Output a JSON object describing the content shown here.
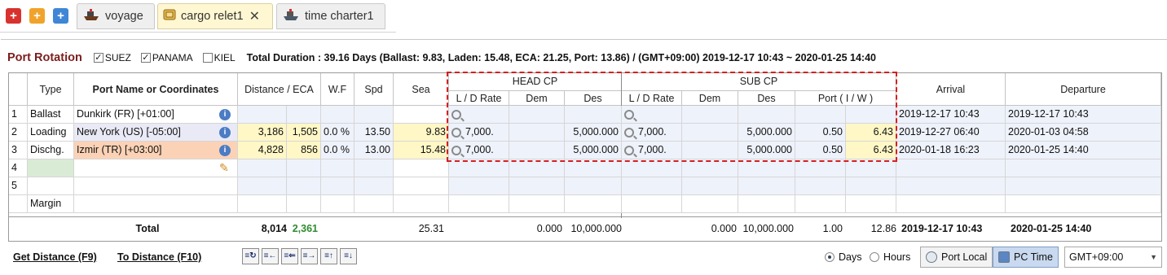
{
  "tabs": [
    {
      "label": "voyage",
      "active": false
    },
    {
      "label": "cargo relet1",
      "active": true
    },
    {
      "label": "time charter1",
      "active": false
    }
  ],
  "header": {
    "title": "Port Rotation",
    "canals": [
      {
        "label": "SUEZ",
        "checked": true
      },
      {
        "label": "PANAMA",
        "checked": true
      },
      {
        "label": "KIEL",
        "checked": false
      }
    ],
    "duration": "Total Duration : 39.16 Days (Ballast: 9.83, Laden: 15.48, ECA: 21.25, Port: 13.86) / (GMT+09:00) 2019-12-17 10:43 ~ 2020-01-25 14:40"
  },
  "grid": {
    "group_headers": {
      "head_cp": "HEAD CP",
      "sub_cp": "SUB CP"
    },
    "columns": {
      "type": "Type",
      "port": "Port Name or Coordinates",
      "distance": "Distance / ECA",
      "wf": "W.F",
      "spd": "Spd",
      "sea": "Sea",
      "ld_rate": "L / D Rate",
      "dem": "Dem",
      "des": "Des",
      "port_iw": "Port ( I / W )",
      "arrival": "Arrival",
      "departure": "Departure"
    },
    "rows": [
      {
        "no": "1",
        "type": "Ballast",
        "port": "Dunkirk (FR) [+01:00]",
        "distance": "",
        "eca": "",
        "wf": "",
        "spd": "",
        "sea": "",
        "h_ld": "",
        "h_dem": "",
        "h_des": "",
        "s_ld": "",
        "s_dem": "",
        "s_des": "",
        "port_i": "",
        "port_w": "",
        "arrival": "2019-12-17 10:43",
        "departure": "2019-12-17 10:43"
      },
      {
        "no": "2",
        "type": "Loading",
        "port": "New York (US) [-05:00]",
        "distance": "3,186",
        "eca": "1,505",
        "wf": "0.0 %",
        "spd": "13.50",
        "sea": "9.83",
        "h_ld": "7,000.",
        "h_dem": "",
        "h_des": "5,000.000",
        "s_ld": "7,000.",
        "s_dem": "",
        "s_des": "5,000.000",
        "port_i": "0.50",
        "port_w": "6.43",
        "arrival": "2019-12-27 06:40",
        "departure": "2020-01-03 04:58"
      },
      {
        "no": "3",
        "type": "Dischg.",
        "port": "Izmir (TR) [+03:00]",
        "distance": "4,828",
        "eca": "856",
        "wf": "0.0 %",
        "spd": "13.00",
        "sea": "15.48",
        "h_ld": "7,000.",
        "h_dem": "",
        "h_des": "5,000.000",
        "s_ld": "7,000.",
        "s_dem": "",
        "s_des": "5,000.000",
        "port_i": "0.50",
        "port_w": "6.43",
        "arrival": "2020-01-18 16:23",
        "departure": "2020-01-25 14:40"
      },
      {
        "no": "4"
      },
      {
        "no": "5"
      },
      {
        "no": "",
        "type": "Margin"
      }
    ],
    "totals": {
      "label": "Total",
      "distance": "8,014",
      "eca": "2,361",
      "sea": "25.31",
      "h_dem": "0.000",
      "h_des": "10,000.000",
      "s_dem": "0.000",
      "s_des": "10,000.000",
      "port_i": "1.00",
      "port_w": "12.86",
      "arrival": "2019-12-17 10:43",
      "departure": "2020-01-25 14:40"
    }
  },
  "bottom": {
    "get_distance": "Get Distance (F9)",
    "to_distance": "To Distance (F10)",
    "days": "Days",
    "hours": "Hours",
    "time_unit_selected": "Days",
    "port_local": "Port Local",
    "pc_time": "PC Time",
    "timezone": "GMT+09:00"
  },
  "colors": {
    "title": "#7b1e1e",
    "eca_total": "#2e8b2e",
    "dashed_highlight": "#d42020",
    "sea_bg": "#fff7c6"
  }
}
